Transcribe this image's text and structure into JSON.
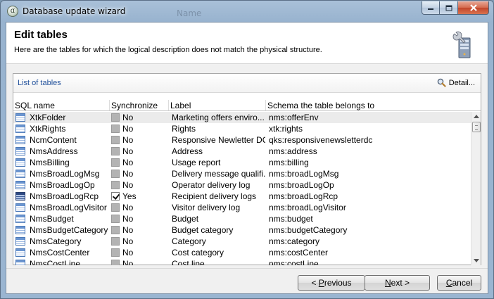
{
  "window": {
    "title": "Database update wizard",
    "background_text": "Name",
    "app_icon_glyph": "ɑ",
    "controls": {
      "minimize": "minimize-icon",
      "maximize": "maximize-icon",
      "close": "close-icon"
    }
  },
  "header": {
    "title": "Edit tables",
    "description": "Here are the tables for which the logical description does not match the physical structure.",
    "icon": "server-wrench-icon"
  },
  "panel": {
    "title": "List of tables",
    "detail_label": "Detail...",
    "detail_icon": "magnifier-icon"
  },
  "table": {
    "columns": [
      "SQL name",
      "Synchronize",
      "Label",
      "Schema the table belongs to"
    ],
    "rows": [
      {
        "sql": "XtkFolder",
        "sync": "No",
        "synced": false,
        "label": "Marketing offers enviro...",
        "schema": "nms:offerEnv"
      },
      {
        "sql": "XtkRights",
        "sync": "No",
        "synced": false,
        "label": "Rights",
        "schema": "xtk:rights"
      },
      {
        "sql": "NcmContent",
        "sync": "No",
        "synced": false,
        "label": "Responsive Newletter DC",
        "schema": "qks:responsivenewsletterdc"
      },
      {
        "sql": "NmsAddress",
        "sync": "No",
        "synced": false,
        "label": "Address",
        "schema": "nms:address"
      },
      {
        "sql": "NmsBilling",
        "sync": "No",
        "synced": false,
        "label": "Usage report",
        "schema": "nms:billing"
      },
      {
        "sql": "NmsBroadLogMsg",
        "sync": "No",
        "synced": false,
        "label": "Delivery message qualifi...",
        "schema": "nms:broadLogMsg"
      },
      {
        "sql": "NmsBroadLogOp",
        "sync": "No",
        "synced": false,
        "label": "Operator delivery log",
        "schema": "nms:broadLogOp"
      },
      {
        "sql": "NmsBroadLogRcp",
        "sync": "Yes",
        "synced": true,
        "label": "Recipient delivery logs",
        "schema": "nms:broadLogRcp"
      },
      {
        "sql": "NmsBroadLogVisitor",
        "sync": "No",
        "synced": false,
        "label": "Visitor delivery log",
        "schema": "nms:broadLogVisitor"
      },
      {
        "sql": "NmsBudget",
        "sync": "No",
        "synced": false,
        "label": "Budget",
        "schema": "nms:budget"
      },
      {
        "sql": "NmsBudgetCategory",
        "sync": "No",
        "synced": false,
        "label": "Budget category",
        "schema": "nms:budgetCategory"
      },
      {
        "sql": "NmsCategory",
        "sync": "No",
        "synced": false,
        "label": "Category",
        "schema": "nms:category"
      },
      {
        "sql": "NmsCostCenter",
        "sync": "No",
        "synced": false,
        "label": "Cost category",
        "schema": "nms:costCenter"
      },
      {
        "sql": "NmsCostLine",
        "sync": "No",
        "synced": false,
        "label": "Cost line",
        "schema": "nms:costLine"
      }
    ]
  },
  "footer": {
    "previous": {
      "prefix": "< ",
      "mnemonic": "P",
      "rest": "revious"
    },
    "next": {
      "mnemonic": "N",
      "rest": "ext >"
    },
    "cancel": {
      "mnemonic": "C",
      "rest": "ancel"
    }
  },
  "colors": {
    "accent_link": "#1f4f9a",
    "selected_row": "#ebebeb"
  }
}
